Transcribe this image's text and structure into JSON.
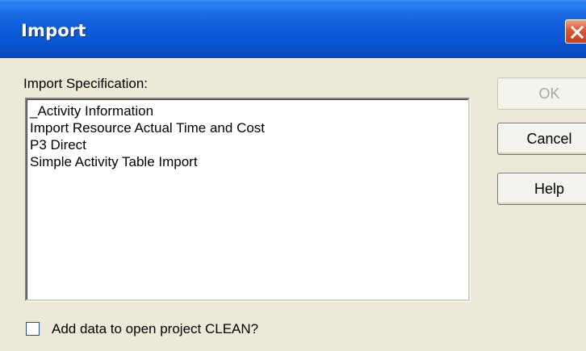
{
  "window": {
    "title": "Import",
    "colors": {
      "titlebar": "#0A55D2",
      "face": "#ECE9D8",
      "close_button": "#DD5A36",
      "disabled_text": "#ACA899"
    },
    "icons": {
      "close": "close-icon"
    }
  },
  "main": {
    "spec_label": "Import Specification:",
    "specifications": [
      "_Activity Information",
      "Import Resource Actual Time and Cost",
      "P3 Direct",
      "Simple Activity Table Import"
    ],
    "add_data_checkbox": {
      "label": "Add data to open project CLEAN?",
      "checked": false
    }
  },
  "buttons": {
    "ok": "OK",
    "cancel": "Cancel",
    "help": "Help"
  }
}
